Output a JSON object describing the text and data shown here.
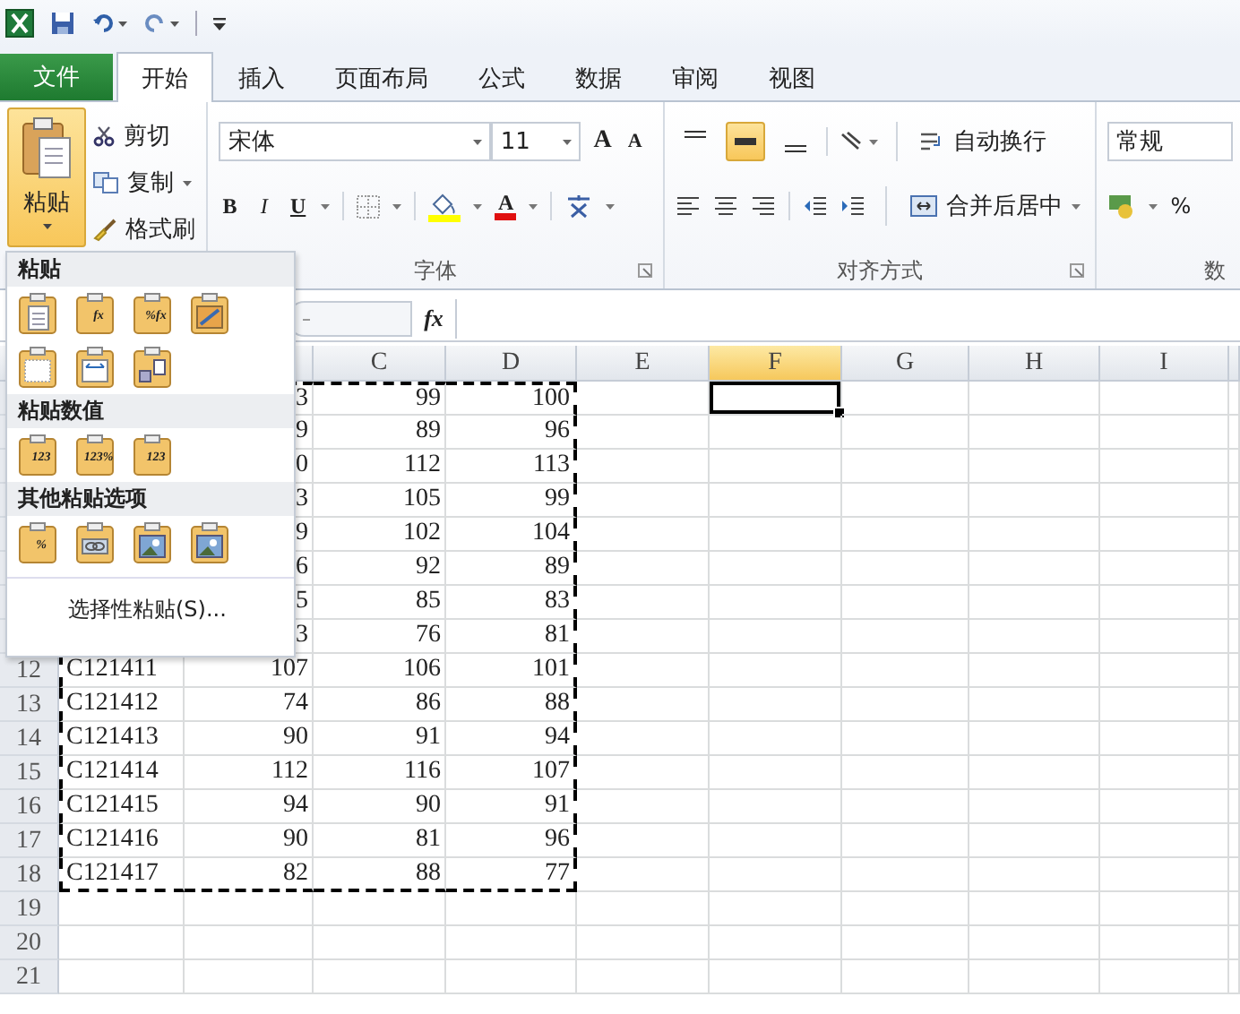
{
  "tabs": [
    {
      "label": "文件",
      "kind": "file",
      "selected": false
    },
    {
      "label": "开始",
      "kind": "tab",
      "selected": true
    },
    {
      "label": "插入",
      "kind": "tab",
      "selected": false
    },
    {
      "label": "页面布局",
      "kind": "tab",
      "selected": false
    },
    {
      "label": "公式",
      "kind": "tab",
      "selected": false
    },
    {
      "label": "数据",
      "kind": "tab",
      "selected": false
    },
    {
      "label": "审阅",
      "kind": "tab",
      "selected": false
    },
    {
      "label": "视图",
      "kind": "tab",
      "selected": false
    }
  ],
  "clipboard": {
    "paste": "粘贴",
    "paste_pressed": true,
    "cut": "剪切",
    "copy": "复制",
    "format_painter": "格式刷"
  },
  "font": {
    "name": "宋体",
    "size": "11",
    "grow": "A",
    "shrink": "A",
    "bold": "B",
    "italic": "I",
    "underline": "U",
    "color_button": "A",
    "label": "字体"
  },
  "alignment": {
    "vertical": [
      {
        "selected": false
      },
      {
        "selected": true
      },
      {
        "selected": false
      }
    ],
    "wrap_text": "自动换行",
    "merge_center": "合并后居中",
    "label": "对齐方式"
  },
  "number": {
    "format": "常规",
    "percent": "%",
    "label": "数"
  },
  "formula_bar": {
    "function_button": "fx"
  },
  "columns": [
    {
      "name": "C",
      "selected": false
    },
    {
      "name": "D",
      "selected": false
    },
    {
      "name": "E",
      "selected": false
    },
    {
      "name": "F",
      "selected": true
    },
    {
      "name": "G",
      "selected": false
    },
    {
      "name": "H",
      "selected": false
    },
    {
      "name": "I",
      "selected": false
    }
  ],
  "rows": [
    {
      "B": "3",
      "C": "99",
      "D": "100",
      "copied": true,
      "selected": true
    },
    {
      "B": "9",
      "C": "89",
      "D": "96",
      "copied": true,
      "selected": false
    },
    {
      "B": "0",
      "C": "112",
      "D": "113",
      "copied": true,
      "selected": false
    },
    {
      "B": "3",
      "C": "105",
      "D": "99",
      "copied": true,
      "selected": false
    },
    {
      "B": "9",
      "C": "102",
      "D": "104",
      "copied": true,
      "selected": false
    },
    {
      "B": "6",
      "C": "92",
      "D": "89",
      "copied": true,
      "selected": false
    },
    {
      "B": "5",
      "C": "85",
      "D": "83",
      "copied": true,
      "selected": false
    },
    {
      "B": "3",
      "C": "76",
      "D": "81",
      "copied": true,
      "selected": false
    },
    {
      "number": "12",
      "A": "C121411",
      "B": "107",
      "C": "106",
      "D": "101",
      "copied": true,
      "selected": false
    },
    {
      "number": "13",
      "A": "C121412",
      "B": "74",
      "C": "86",
      "D": "88",
      "copied": true,
      "selected": false
    },
    {
      "number": "14",
      "A": "C121413",
      "B": "90",
      "C": "91",
      "D": "94",
      "copied": true,
      "selected": false
    },
    {
      "number": "15",
      "A": "C121414",
      "B": "112",
      "C": "116",
      "D": "107",
      "copied": true,
      "selected": false
    },
    {
      "number": "16",
      "A": "C121415",
      "B": "94",
      "C": "90",
      "D": "91",
      "copied": true,
      "selected": false
    },
    {
      "number": "17",
      "A": "C121416",
      "B": "90",
      "C": "81",
      "D": "96",
      "copied": true,
      "selected": false
    },
    {
      "number": "18",
      "A": "C121417",
      "B": "82",
      "C": "88",
      "D": "77",
      "copied": true,
      "selected": false
    },
    {
      "number": "19",
      "copied": false,
      "selected": false
    },
    {
      "number": "20",
      "copied": false,
      "selected": false
    },
    {
      "number": "21",
      "copied": false,
      "selected": false
    }
  ],
  "paste_menu": {
    "sections": [
      {
        "title": "粘贴",
        "items": [
          {
            "kind": "paste"
          },
          {
            "kind": "formulas",
            "glyph": "fx"
          },
          {
            "kind": "formulas_number",
            "glyph": "%fx"
          },
          {
            "kind": "keep_source"
          },
          {
            "kind": "no_borders"
          },
          {
            "kind": "keep_widths"
          },
          {
            "kind": "transpose"
          }
        ]
      },
      {
        "title": "粘贴数值",
        "items": [
          {
            "kind": "values",
            "glyph": "123"
          },
          {
            "kind": "values_number",
            "glyph": "123%"
          },
          {
            "kind": "values_source",
            "glyph": "123"
          }
        ]
      },
      {
        "title": "其他粘贴选项",
        "items": [
          {
            "kind": "formatting",
            "glyph": "%"
          },
          {
            "kind": "link"
          },
          {
            "kind": "picture"
          },
          {
            "kind": "linked_picture"
          }
        ]
      }
    ],
    "special": "选择性粘贴(S)..."
  }
}
